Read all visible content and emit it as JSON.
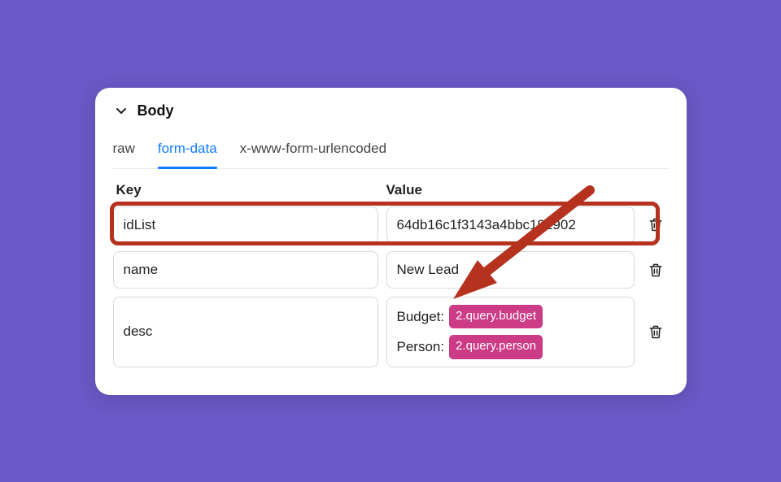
{
  "section_title": "Body",
  "tabs": [
    {
      "label": "raw",
      "active": false
    },
    {
      "label": "form-data",
      "active": true
    },
    {
      "label": "x-www-form-urlencoded",
      "active": false
    }
  ],
  "columns": {
    "key": "Key",
    "value": "Value"
  },
  "rows": [
    {
      "key": "idList",
      "value_text": "64db16c1f3143a4bbc192902",
      "highlighted": true
    },
    {
      "key": "name",
      "value_text": "New Lead"
    },
    {
      "key": "desc",
      "value_rich": [
        {
          "label": "Budget:",
          "tag": "2.query.budget"
        },
        {
          "label": "Person:",
          "tag": "2.query.person"
        }
      ]
    }
  ],
  "colors": {
    "accent": "#0f7dff",
    "highlight_border": "#b5321e",
    "tag_bg": "#cc3b86",
    "page_bg": "#6a59c6"
  }
}
